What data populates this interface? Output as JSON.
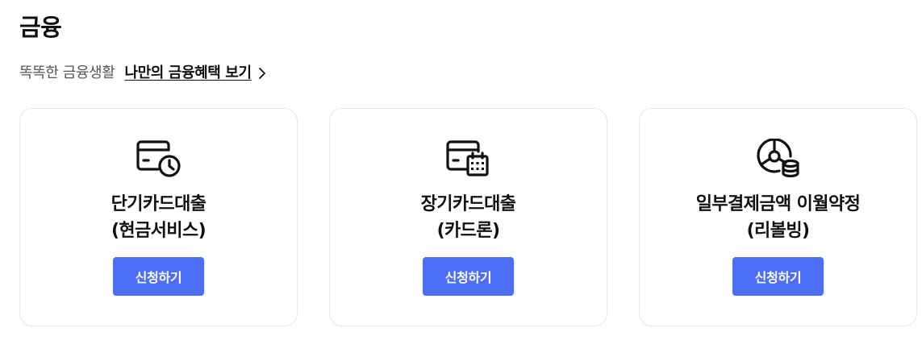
{
  "section": {
    "title": "금융"
  },
  "subline": {
    "description": "똑똑한 금융생활",
    "link_label": "나만의 금융혜택 보기",
    "link_icon": "chevron-right-icon"
  },
  "cards": [
    {
      "icon": "card-clock-icon",
      "title_line1": "단기카드대출",
      "title_line2": "(현금서비스)",
      "button_label": "신청하기"
    },
    {
      "icon": "card-calendar-icon",
      "title_line1": "장기카드대출",
      "title_line2": "(카드론)",
      "button_label": "신청하기"
    },
    {
      "icon": "pie-chart-coins-icon",
      "title_line1": "일부결제금액 이월약정",
      "title_line2": "(리볼빙)",
      "button_label": "신청하기"
    }
  ],
  "colors": {
    "button_bg": "#4b6ef5",
    "card_border": "#e6e6ea",
    "text": "#111111",
    "muted_text": "#555555"
  }
}
